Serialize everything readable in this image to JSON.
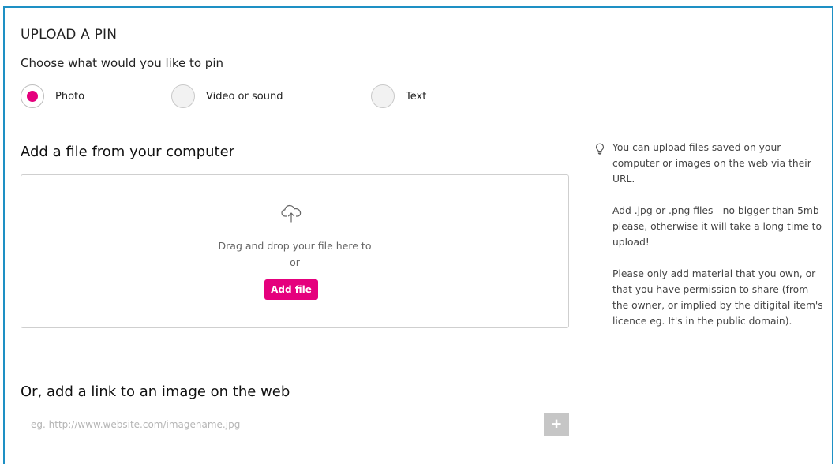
{
  "header": {
    "title": "UPLOAD A PIN",
    "prompt": "Choose what would you like to pin"
  },
  "pin_types": [
    {
      "label": "Photo",
      "selected": true
    },
    {
      "label": "Video or sound",
      "selected": false
    },
    {
      "label": "Text",
      "selected": false
    }
  ],
  "upload": {
    "title": "Add a file from your computer",
    "drop_text": "Drag and drop your file here to",
    "or_text": "or",
    "button_label": "Add file"
  },
  "link": {
    "title": "Or, add a link to an image on the web",
    "placeholder": "eg. http://www.website.com/imagename.jpg"
  },
  "tips": [
    "You can upload files saved on your computer or images on the web via their URL.",
    "Add .jpg or .png files - no bigger than 5mb please, otherwise it will take a long time to upload!",
    "Please only add material that you own, or that you have permission to share (from the owner, or implied by the ditigital item's licence eg. It's in the public domain)."
  ],
  "colors": {
    "accent": "#e5007d",
    "panel_border": "#1e90c4",
    "plus_button": "#c6c6c6"
  }
}
